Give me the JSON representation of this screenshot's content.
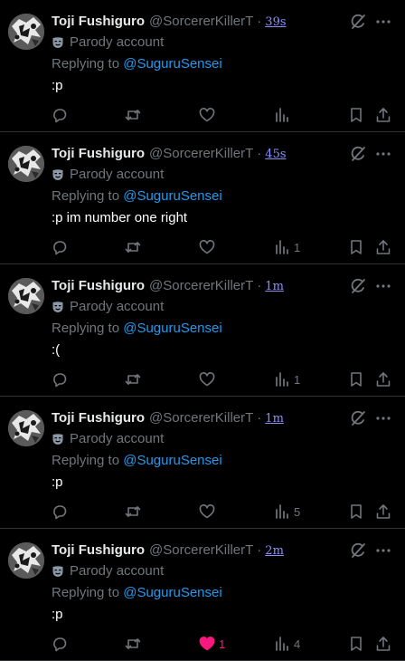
{
  "author": {
    "name": "Toji Fushiguro",
    "handle": "@SorcererKillerT",
    "badge_label": "Parody account"
  },
  "reply_prefix": "Replying to",
  "reply_to": "@SuguruSensei",
  "separator": "·",
  "colors": {
    "background": "#000000",
    "secondary_text": "#71767b",
    "mention": "#1d9bf0",
    "like_active": "#f91880",
    "timestamp_link": "#8a8fff"
  },
  "icons": {
    "grok": "grok-icon",
    "more": "more-icon",
    "parody": "parody-mask-icon",
    "reply": "reply-icon",
    "repost": "repost-icon",
    "like": "like-icon",
    "views": "views-icon",
    "bookmark": "bookmark-icon",
    "share": "share-icon"
  },
  "tweets": [
    {
      "time": "39s",
      "text": ":p",
      "likes": "",
      "liked": false,
      "views": ""
    },
    {
      "time": "45s",
      "text": ":p im number one right",
      "likes": "",
      "liked": false,
      "views": "1"
    },
    {
      "time": "1m",
      "text": ":(",
      "likes": "",
      "liked": false,
      "views": "1"
    },
    {
      "time": "1m",
      "text": ":p",
      "likes": "",
      "liked": false,
      "views": "5"
    },
    {
      "time": "2m",
      "text": ":p",
      "likes": "1",
      "liked": true,
      "views": "4"
    }
  ]
}
